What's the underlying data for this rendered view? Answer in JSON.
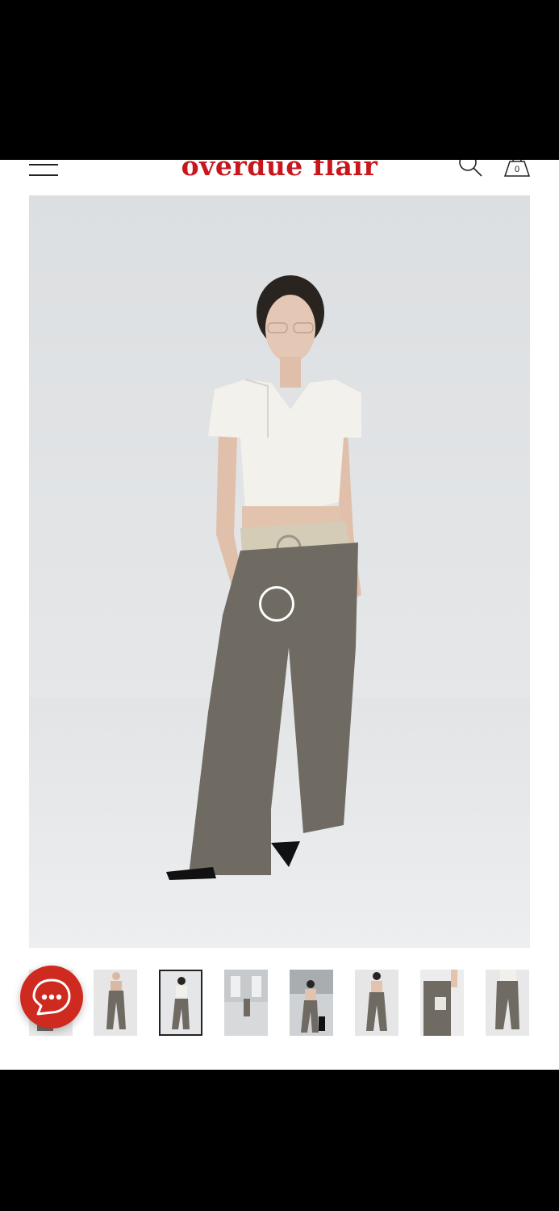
{
  "header": {
    "brand": "overdue flair",
    "cart_count": "0",
    "menu_icon": "hamburger-menu-icon",
    "search_icon": "search-icon",
    "cart_icon": "shopping-bag-icon"
  },
  "colors": {
    "brand_red": "#c8161d",
    "chat_button": "#cf2a1f",
    "pants": "#6f6b63",
    "background": "#e2e4e6"
  },
  "gallery": {
    "thumbnail_count": 8,
    "selected_index": 2
  },
  "chat": {
    "icon": "chat-bubble-icon"
  }
}
